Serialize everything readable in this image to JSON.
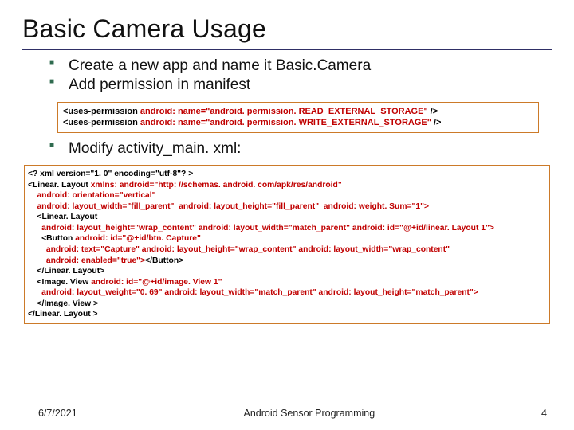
{
  "title": "Basic Camera Usage",
  "bullets_a": {
    "b1": "Create a new app and name it Basic.Camera",
    "b2": "Add permission in manifest"
  },
  "codebox1": {
    "l1a": "<uses-permission ",
    "l1b": "android: name=\"android. permission. READ_EXTERNAL_STORAGE\" ",
    "l1c": "/>",
    "l2a": "<uses-permission ",
    "l2b": "android: name=\"android. permission. WRITE_EXTERNAL_STORAGE\" ",
    "l2c": "/>"
  },
  "bullets_b": {
    "b1": "Modify activity_main. xml:"
  },
  "codebox2": {
    "l1": "<? xml version=\"1. 0\" encoding=\"utf-8\"? >",
    "l2a": "<Linear. Layout ",
    "l2b": "xmlns: android=\"http: //schemas. android. com/apk/res/android\"",
    "l3": "    android: orientation=\"vertical\"",
    "l4": "    android: layout_width=\"fill_parent\"  android: layout_height=\"fill_parent\"  android: weight. Sum=\"1\">",
    "l5": "    <Linear. Layout",
    "l6": "      android: layout_height=\"wrap_content\" android: layout_width=\"match_parent\" android: id=\"@+id/linear. Layout 1\">",
    "l7a": "      <Button ",
    "l7b": "android: id=\"@+id/btn. Capture\"",
    "l8": "        android: text=\"Capture\" android: layout_height=\"wrap_content\" android: layout_width=\"wrap_content\"",
    "l9a": "        android: enabled=\"true\">",
    "l9b": "</Button>",
    "l10": "    </Linear. Layout>",
    "l11a": "    <Image. View ",
    "l11b": "android: id=\"@+id/image. View 1\"",
    "l12": "      android: layout_weight=\"0. 69\" android: layout_width=\"match_parent\" android: layout_height=\"match_parent\">",
    "l13": "    </Image. View >",
    "l14": "</Linear. Layout >"
  },
  "footer": {
    "date": "6/7/2021",
    "mid": "Android Sensor Programming",
    "page": "4"
  }
}
